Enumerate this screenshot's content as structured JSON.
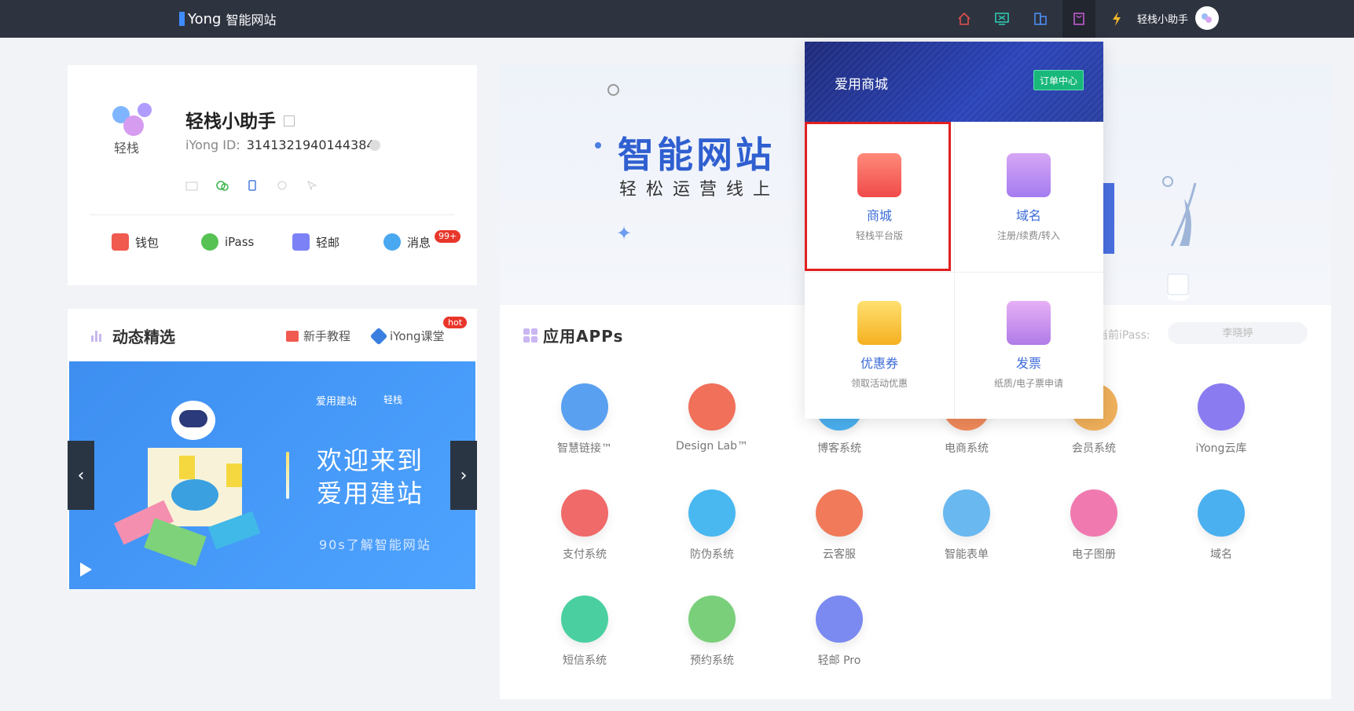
{
  "topbar": {
    "logo_prefix": "Yong",
    "logo_cn": "智能网站",
    "user_name": "轻栈小助手",
    "icons": [
      "home-icon",
      "monitor-icon",
      "building-icon",
      "shop-icon",
      "lightning-icon"
    ]
  },
  "profile": {
    "logo_text": "轻栈",
    "name": "轻栈小助手",
    "id_label": "iYong ID:",
    "id_value": "3141321940144384",
    "links": [
      {
        "label": "钱包",
        "icon": "wallet-icon",
        "color": "#f05a4f"
      },
      {
        "label": "iPass",
        "icon": "key-icon",
        "color": "#55c253"
      },
      {
        "label": "轻邮",
        "icon": "mail-icon",
        "color": "#7c82f5"
      },
      {
        "label": "消息",
        "icon": "chat-icon",
        "color": "#4aa8f0"
      }
    ],
    "message_badge": "99+"
  },
  "dynamic": {
    "title": "动态精选",
    "tutorial": "新手教程",
    "course": "iYong课堂",
    "hot": "hot",
    "banner": {
      "brand": "爱用建站",
      "brand2": "轻栈",
      "headline_1": "欢迎来到",
      "headline_2": "爱用建站",
      "sub": "90s了解智能网站"
    }
  },
  "hero": {
    "title": "智能网站",
    "subtitle": "轻松运营线上"
  },
  "apps": {
    "title": "应用APPs",
    "ipass_label": "当前iPass:",
    "ipass_value": "李晓婷",
    "items": [
      {
        "label": "智慧链接™",
        "color": "#5aa0f0"
      },
      {
        "label": "Design Lab™",
        "color": "#f0705a"
      },
      {
        "label": "博客系统",
        "color": "#4ab0f0"
      },
      {
        "label": "电商系统",
        "color": "#f08a5a"
      },
      {
        "label": "会员系统",
        "color": "#f0b05a"
      },
      {
        "label": "iYong云库",
        "color": "#8a7cf0"
      },
      {
        "label": "支付系统",
        "color": "#f06a6a"
      },
      {
        "label": "防伪系统",
        "color": "#4ab8f0"
      },
      {
        "label": "云客服",
        "color": "#f07a5a"
      },
      {
        "label": "智能表单",
        "color": "#6ab8f0"
      },
      {
        "label": "电子图册",
        "color": "#f07ab0"
      },
      {
        "label": "域名",
        "color": "#4ab0f0"
      },
      {
        "label": "短信系统",
        "color": "#4ad0a0"
      },
      {
        "label": "预约系统",
        "color": "#7ad07a"
      },
      {
        "label": "轻邮 Pro",
        "color": "#7a8af0"
      }
    ]
  },
  "shop_dropdown": {
    "title": "爱用商城",
    "order_center": "订单中心",
    "cells": [
      {
        "title": "商城",
        "sub": "轻栈平台版",
        "icon": "shopping-bag-icon"
      },
      {
        "title": "域名",
        "sub": "注册/续费/转入",
        "icon": "domain-bag-icon"
      },
      {
        "title": "优惠券",
        "sub": "领取活动优惠",
        "icon": "coupon-icon"
      },
      {
        "title": "发票",
        "sub": "纸质/电子票申请",
        "icon": "invoice-icon"
      }
    ]
  }
}
